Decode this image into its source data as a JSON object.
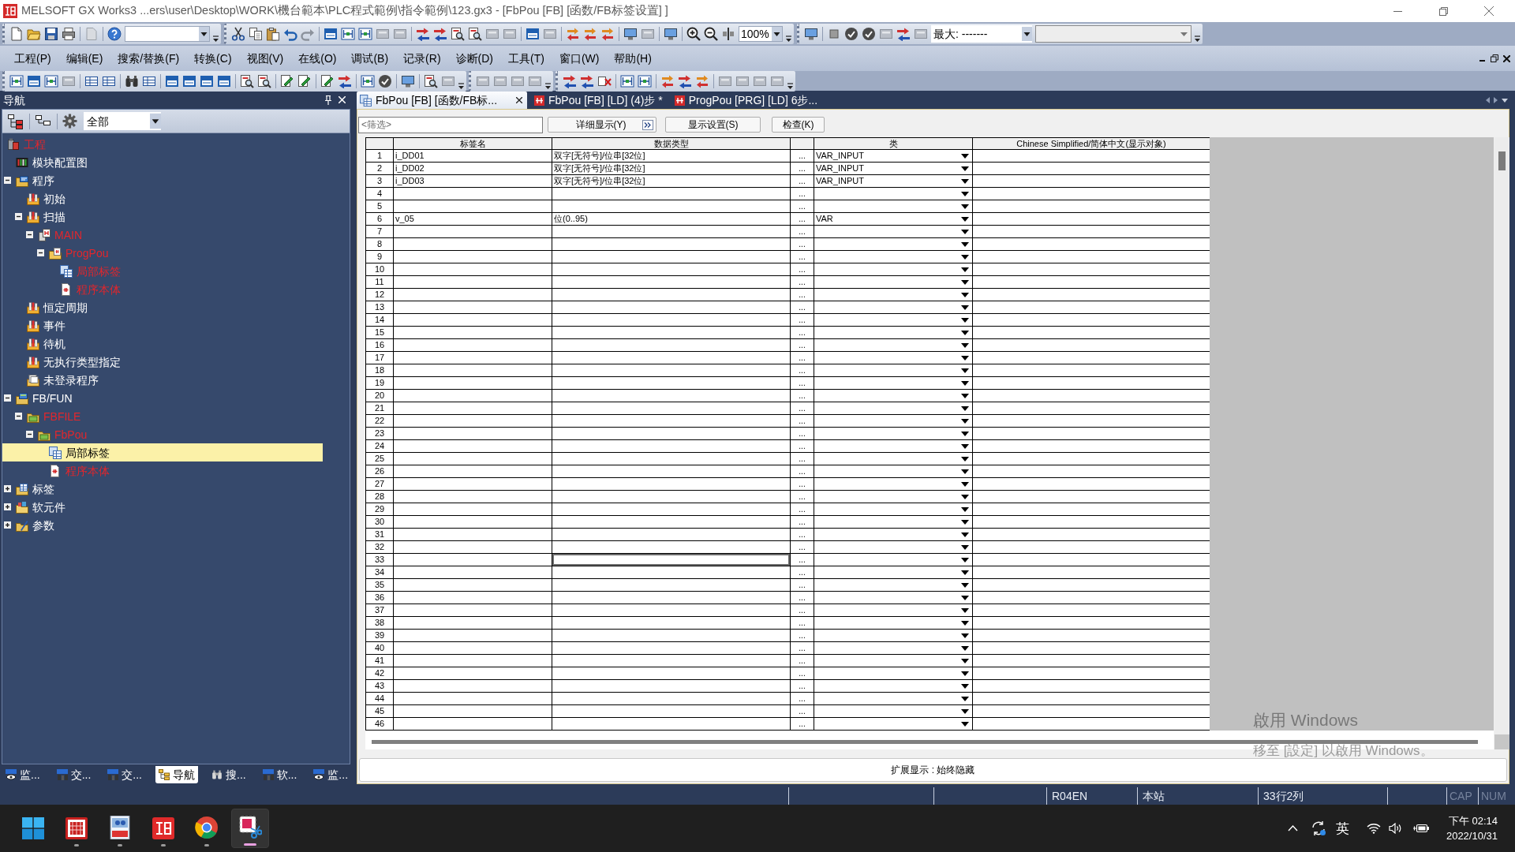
{
  "window": {
    "title": "MELSOFT GX Works3 ...ers\\user\\Desktop\\WORK\\機台範本\\PLC程式範例\\指令範例\\123.gx3 - [FbPou [FB] [函数/FB标签设置] ]"
  },
  "toolbar": {
    "zoom": "100%",
    "max_cycle": "最大: -------"
  },
  "menu": [
    "工程(P)",
    "编辑(E)",
    "搜索/替换(F)",
    "转换(C)",
    "视图(V)",
    "在线(O)",
    "调试(B)",
    "记录(R)",
    "诊断(D)",
    "工具(T)",
    "窗口(W)",
    "帮助(H)"
  ],
  "navigation": {
    "title": "导航",
    "view": "全部",
    "tree": [
      {
        "label": "工程",
        "kind": "project",
        "unconverted": true,
        "selected": false,
        "children": [
          {
            "label": "模块配置图",
            "kind": "module-config",
            "unconverted": false,
            "selected": false
          },
          {
            "label": "程序",
            "kind": "program-folder",
            "expanded": true,
            "unconverted": false,
            "selected": false,
            "children": [
              {
                "label": "初始",
                "kind": "task",
                "unconverted": false,
                "selected": false
              },
              {
                "label": "扫描",
                "kind": "task",
                "expanded": true,
                "unconverted": false,
                "selected": false,
                "children": [
                  {
                    "label": "MAIN",
                    "kind": "program-file",
                    "expanded": true,
                    "unconverted": true,
                    "selected": false,
                    "children": [
                      {
                        "label": "ProgPou",
                        "kind": "pou",
                        "expanded": true,
                        "unconverted": true,
                        "selected": false,
                        "children": [
                          {
                            "label": "局部标签",
                            "kind": "local-labels",
                            "unconverted": true,
                            "selected": false
                          },
                          {
                            "label": "程序本体",
                            "kind": "program-body",
                            "unconverted": true,
                            "selected": false
                          }
                        ]
                      }
                    ]
                  }
                ]
              },
              {
                "label": "恒定周期",
                "kind": "task",
                "unconverted": false,
                "selected": false
              },
              {
                "label": "事件",
                "kind": "task",
                "unconverted": false,
                "selected": false
              },
              {
                "label": "待机",
                "kind": "task",
                "unconverted": false,
                "selected": false
              },
              {
                "label": "无执行类型指定",
                "kind": "task",
                "unconverted": false,
                "selected": false
              },
              {
                "label": "未登录程序",
                "kind": "unregistered",
                "unconverted": false,
                "selected": false
              }
            ]
          },
          {
            "label": "FB/FUN",
            "kind": "fb-folder",
            "expanded": true,
            "unconverted": false,
            "selected": false,
            "children": [
              {
                "label": "FBFILE",
                "kind": "folder",
                "expanded": true,
                "unconverted": true,
                "selected": false,
                "children": [
                  {
                    "label": "FbPou",
                    "kind": "folder",
                    "expanded": true,
                    "unconverted": true,
                    "selected": false,
                    "children": [
                      {
                        "label": "局部标签",
                        "kind": "local-labels",
                        "unconverted": false,
                        "selected": true
                      },
                      {
                        "label": "程序本体",
                        "kind": "program-body",
                        "unconverted": true,
                        "selected": false
                      }
                    ]
                  }
                ]
              }
            ]
          },
          {
            "label": "标签",
            "kind": "labels",
            "expanded": false,
            "unconverted": false,
            "selected": false
          },
          {
            "label": "软元件",
            "kind": "devices",
            "expanded": false,
            "unconverted": false,
            "selected": false
          },
          {
            "label": "参数",
            "kind": "parameters",
            "expanded": false,
            "unconverted": false,
            "selected": false
          }
        ]
      }
    ],
    "tabs": [
      {
        "label": "监...",
        "kind": "watch",
        "selected": false
      },
      {
        "label": "交...",
        "kind": "cross-reference",
        "selected": false
      },
      {
        "label": "交...",
        "kind": "cross-reference",
        "selected": false
      },
      {
        "label": "导航",
        "kind": "navigation",
        "selected": true
      },
      {
        "label": "搜...",
        "kind": "search",
        "selected": false
      },
      {
        "label": "软...",
        "kind": "device",
        "selected": false
      },
      {
        "label": "监...",
        "kind": "watch",
        "selected": false
      }
    ]
  },
  "editor": {
    "tabs": [
      {
        "label": "FbPou [FB] [函数/FB标...",
        "kind": "label-table",
        "selected": true
      },
      {
        "label": "FbPou [FB] [LD] (4)步 *",
        "kind": "ladder",
        "selected": false
      },
      {
        "label": "ProgPou [PRG] [LD] 6步...",
        "kind": "ladder",
        "selected": false
      }
    ],
    "filter": {
      "placeholder": "<筛选>"
    },
    "buttons": [
      {
        "label": "详细显示(Y)",
        "kind": "expand"
      },
      {
        "label": "显示设置(S)",
        "kind": "plain"
      },
      {
        "label": "检查(K)",
        "kind": "plain"
      }
    ],
    "table": {
      "columns": [
        "标签名",
        "数据类型",
        "类",
        "Chinese Simplified/简体中文(显示对象)"
      ],
      "rows": [
        {
          "number": "1",
          "label": "i_DD01",
          "data_type": "双字[无符号]/位串[32位]",
          "browse": "...",
          "class": "VAR_INPUT",
          "selected": false
        },
        {
          "number": "2",
          "label": "i_DD02",
          "data_type": "双字[无符号]/位串[32位]",
          "browse": "...",
          "class": "VAR_INPUT",
          "selected": false
        },
        {
          "number": "3",
          "label": "i_DD03",
          "data_type": "双字[无符号]/位串[32位]",
          "browse": "...",
          "class": "VAR_INPUT",
          "selected": false
        },
        {
          "number": "4",
          "browse": "...",
          "selected": false
        },
        {
          "number": "5",
          "browse": "...",
          "selected": false
        },
        {
          "number": "6",
          "label": "v_05",
          "data_type": "位(0..95)",
          "browse": "...",
          "class": "VAR",
          "selected": false
        },
        {
          "number": "7",
          "browse": "...",
          "selected": false
        },
        {
          "number": "8",
          "browse": "...",
          "selected": false
        },
        {
          "number": "9",
          "browse": "...",
          "selected": false
        },
        {
          "number": "10",
          "browse": "...",
          "selected": false
        },
        {
          "number": "11",
          "browse": "...",
          "selected": false
        },
        {
          "number": "12",
          "browse": "...",
          "selected": false
        },
        {
          "number": "13",
          "browse": "...",
          "selected": false
        },
        {
          "number": "14",
          "browse": "...",
          "selected": false
        },
        {
          "number": "15",
          "browse": "...",
          "selected": false
        },
        {
          "number": "16",
          "browse": "...",
          "selected": false
        },
        {
          "number": "17",
          "browse": "...",
          "selected": false
        },
        {
          "number": "18",
          "browse": "...",
          "selected": false
        },
        {
          "number": "19",
          "browse": "...",
          "selected": false
        },
        {
          "number": "20",
          "browse": "...",
          "selected": false
        },
        {
          "number": "21",
          "browse": "...",
          "selected": false
        },
        {
          "number": "22",
          "browse": "...",
          "selected": false
        },
        {
          "number": "23",
          "browse": "...",
          "selected": false
        },
        {
          "number": "24",
          "browse": "...",
          "selected": false
        },
        {
          "number": "25",
          "browse": "...",
          "selected": false
        },
        {
          "number": "26",
          "browse": "...",
          "selected": false
        },
        {
          "number": "27",
          "browse": "...",
          "selected": false
        },
        {
          "number": "28",
          "browse": "...",
          "selected": false
        },
        {
          "number": "29",
          "browse": "...",
          "selected": false
        },
        {
          "number": "30",
          "browse": "...",
          "selected": false
        },
        {
          "number": "31",
          "browse": "...",
          "selected": false
        },
        {
          "number": "32",
          "browse": "...",
          "selected": false
        },
        {
          "number": "33",
          "browse": "...",
          "selected": true
        },
        {
          "number": "34",
          "browse": "...",
          "selected": false
        },
        {
          "number": "35",
          "browse": "...",
          "selected": false
        },
        {
          "number": "36",
          "browse": "...",
          "selected": false
        },
        {
          "number": "37",
          "browse": "...",
          "selected": false
        },
        {
          "number": "38",
          "browse": "...",
          "selected": false
        },
        {
          "number": "39",
          "browse": "...",
          "selected": false
        },
        {
          "number": "40",
          "browse": "...",
          "selected": false
        },
        {
          "number": "41",
          "browse": "...",
          "selected": false
        },
        {
          "number": "42",
          "browse": "...",
          "selected": false
        },
        {
          "number": "43",
          "browse": "...",
          "selected": false
        },
        {
          "number": "44",
          "browse": "...",
          "selected": false
        },
        {
          "number": "45",
          "browse": "...",
          "selected": false
        },
        {
          "number": "46",
          "browse": "...",
          "selected": false
        }
      ]
    },
    "extended_display": "扩展显示 : 始终隐藏"
  },
  "status_bar": {
    "cpu": "R04EN",
    "station": "本站",
    "position": "33行2列",
    "cap": {
      "label": "CAP",
      "on": false
    },
    "num": {
      "label": "NUM",
      "on": false
    }
  },
  "activation_notice": {
    "title": "啟用 Windows",
    "message": "移至 [設定] 以啟用 Windows。"
  },
  "taskbar": {
    "apps": [
      {
        "kind": "grid",
        "active": false
      },
      {
        "kind": "pdf",
        "active": false
      },
      {
        "kind": "logo",
        "active": false
      },
      {
        "kind": "browser",
        "active": false
      },
      {
        "kind": "snipping",
        "active": true
      }
    ],
    "ime": "英",
    "time": "下午 02:14",
    "date": "2022/10/31"
  }
}
